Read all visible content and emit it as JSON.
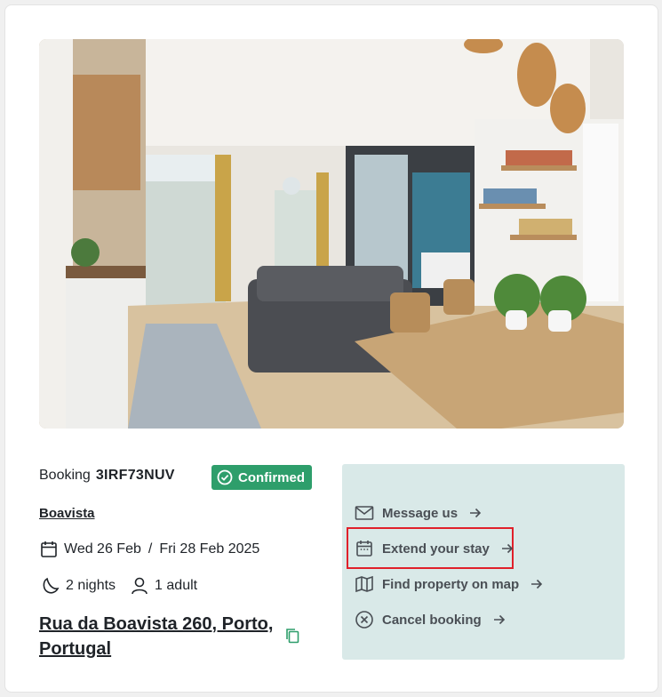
{
  "booking": {
    "label": "Booking",
    "number": "3IRF73NUV",
    "status": "Confirmed",
    "status_color": "#2e9e6b"
  },
  "property": {
    "area": "Boavista",
    "checkin": "Wed 26 Feb",
    "separator": "/",
    "checkout": "Fri 28 Feb 2025",
    "nights": "2 nights",
    "guests": "1 adult",
    "address": "Rua da Boavista 260, Porto, Portugal"
  },
  "actions": {
    "message": "Message us",
    "extend": "Extend your stay",
    "map": "Find property on map",
    "cancel": "Cancel booking",
    "panel_color": "#d9e9e8",
    "highlight_color": "#e0202a"
  },
  "icons": {
    "photo": "apartment-photo",
    "status": "check-circle-icon",
    "calendar": "calendar-icon",
    "moon": "moon-icon",
    "person": "person-icon",
    "copy": "copy-icon",
    "envelope": "envelope-icon",
    "map": "map-icon",
    "cancel": "x-circle-icon",
    "arrow": "arrow-right-icon"
  }
}
